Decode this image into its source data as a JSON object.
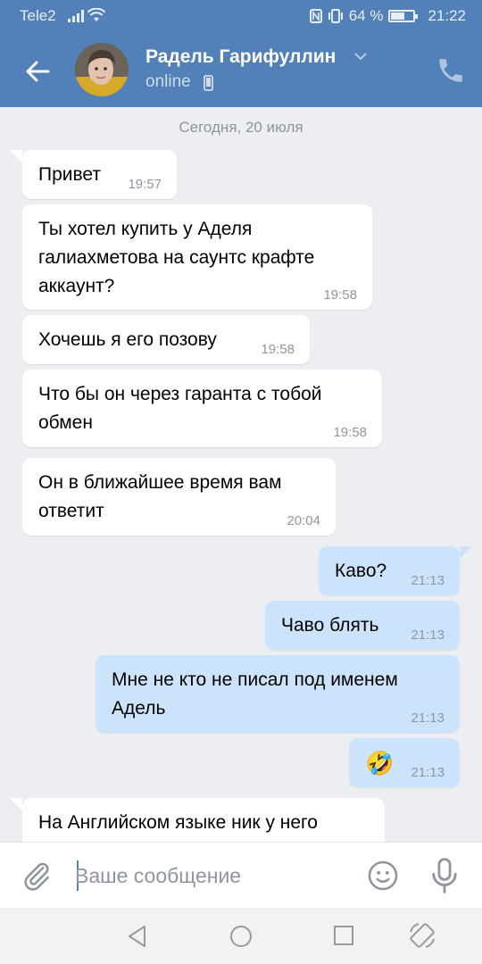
{
  "status_bar": {
    "carrier": "Tele2",
    "battery_percent": "64 %",
    "battery_level": 0.64,
    "time": "21:22"
  },
  "header": {
    "contact_name": "Радель Гарифуллин",
    "status": "online",
    "colors": {
      "bar": "#5181b8",
      "text": "#ffffff"
    }
  },
  "chat": {
    "date_separator": "Сегодня, 20 июля",
    "messages": [
      {
        "direction": "in",
        "text": "Привет",
        "time": "19:57"
      },
      {
        "direction": "in",
        "text": "Ты хотел купить у  Аделя галиахметова на саунтс крафте аккаунт?",
        "time": "19:58"
      },
      {
        "direction": "in",
        "text": "Хочешь я его позову",
        "time": "19:58"
      },
      {
        "direction": "in",
        "text": "Что бы он через гаранта с тобой обмен",
        "time": "19:58"
      },
      {
        "direction": "in",
        "text": "Он в ближайшее время вам ответит",
        "time": "20:04"
      },
      {
        "direction": "out",
        "text": "Каво?",
        "time": "21:13"
      },
      {
        "direction": "out",
        "text": "Чаво блять",
        "time": "21:13"
      },
      {
        "direction": "out",
        "text": "Мне не кто не писал под именем Адель",
        "time": "21:13"
      },
      {
        "direction": "out",
        "text": "🤣",
        "time": "21:13"
      },
      {
        "direction": "in",
        "text": "На Английском языке ник у него",
        "time": ""
      }
    ]
  },
  "composer": {
    "placeholder": "Ваше сообщение",
    "value": ""
  },
  "icons": {
    "back": "arrow-left-icon",
    "call": "phone-icon",
    "attach": "paperclip-icon",
    "emoji": "smiley-icon",
    "mic": "microphone-icon"
  }
}
